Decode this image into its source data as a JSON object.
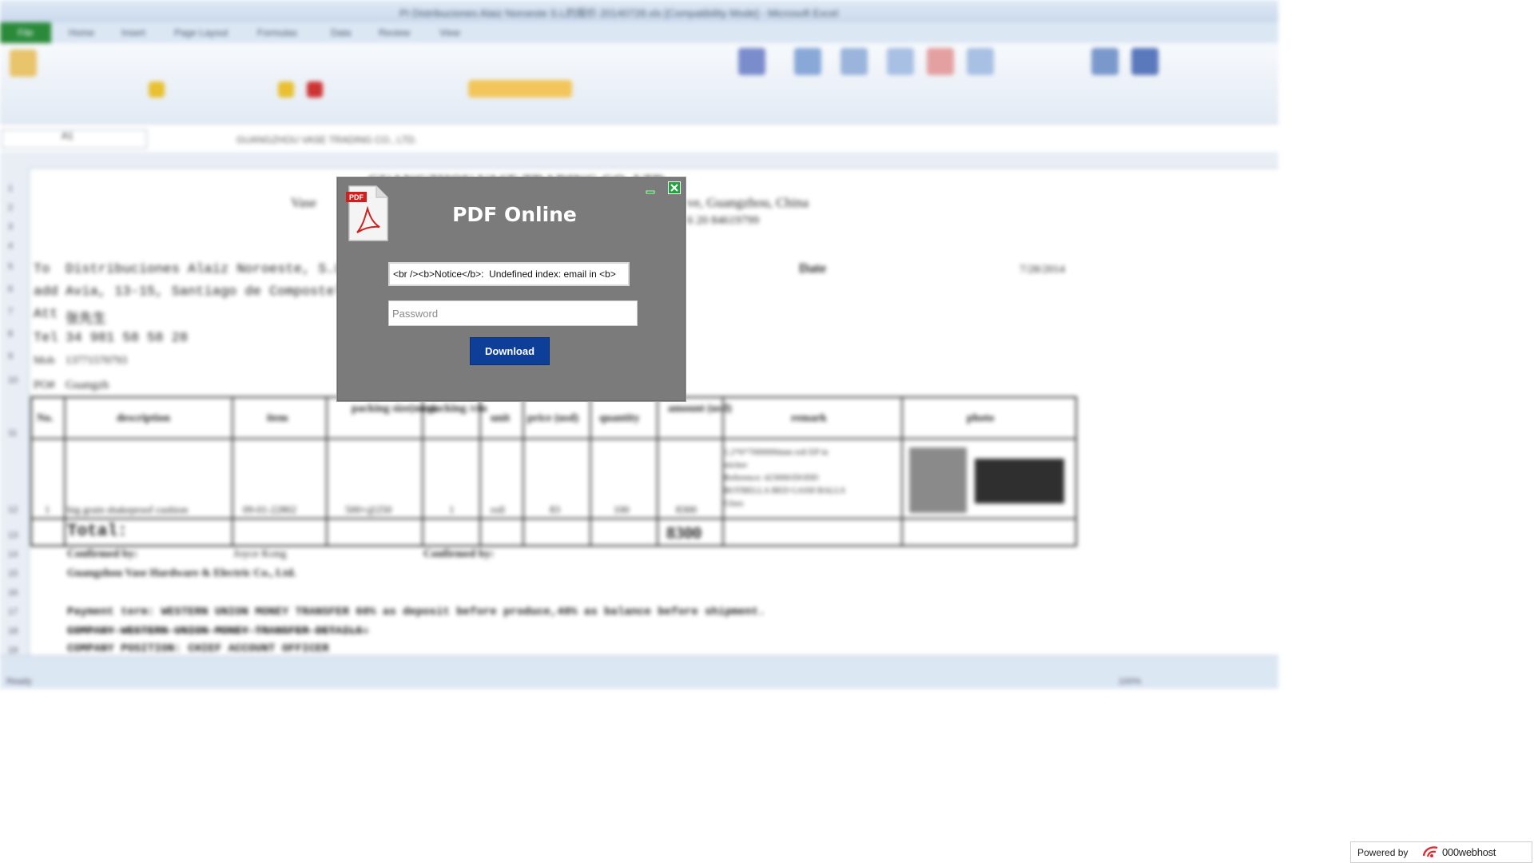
{
  "background": {
    "window_title": "PI Distribuciones Alaiz Noroeste S.L的报价 20140728.xls [Compatibility Mode] - Microsoft Excel",
    "file_tab": "File",
    "tabs": [
      "Home",
      "Insert",
      "Page Layout",
      "Formulas",
      "Data",
      "Review",
      "View"
    ],
    "name_box": "A1",
    "formula_text": "GUANGZHOU VASE TRADING CO., LTD.",
    "company_title": "GUANGZHOU VASE TRADING CO.,LTD.",
    "address_left": "Vase",
    "address_right": "ve, Guangzhou, China",
    "phone_fragment": "6 20 84619799",
    "to_label": "To",
    "to_value": "Distribuciones Alaiz Noroeste, S.L",
    "add_label": "add",
    "add_value": "Avia, 13-15, Santiago de Compostela,",
    "att_label": "Att",
    "att_value": "张先生",
    "tel_label": "Tel",
    "tel_value": "34 981 58 58 28",
    "mob_label": "Mob",
    "mob_value": "13771570793",
    "po_label": "PO#",
    "po_value": "Guangzh",
    "date_label": "Date",
    "date_value": "7/28/2014",
    "table_headers": [
      "No.",
      "description",
      "item",
      "packing size(mm)",
      "packing /ctn",
      "unit",
      "price (usd)",
      "quantity",
      "amount (usd)",
      "remark",
      "photo"
    ],
    "row_values": [
      "1",
      "big grain shakeproof cushion",
      "09-01-22802",
      "500×@250",
      "1",
      "roll",
      "83",
      "100",
      "8300"
    ],
    "remark_lines": [
      "1.2*6*7000000mm roll EP in",
      "sticker",
      "Reference: 423000/DODD",
      "BOTBELLA BED GASH BALLS",
      "Glass"
    ],
    "total_label": "Total:",
    "total_value": "8300",
    "confirmed_by_1": "Confirmed by:",
    "confirmed_name": "Joyce Kong",
    "confirmed_by_2": "Confirmed by:",
    "company_line": "Guangzhou Vase Hardware & Electric Co., Ltd.",
    "payment_line": "Payment term: WESTERN UNION MONEY TRANSFER 60% as deposit before produce,40% as balance before shipment.",
    "western_line": "COMPANY WESTERN UNION MONEY TRANSFER DETAILS:",
    "position_line": "COMPANY POSITION: CHIEF ACCOUNT OFFICER",
    "row_numbers": [
      "1",
      "2",
      "3",
      "4",
      "5",
      "6",
      "7",
      "8",
      "9",
      "10",
      "11",
      "12",
      "13",
      "14",
      "15",
      "16",
      "17",
      "18",
      "19"
    ],
    "status_text": "Ready",
    "zoom": "100%"
  },
  "modal": {
    "pdf_badge": "PDF",
    "title": "PDF Online",
    "email_value": "<br /><b>Notice</b>:  Undefined index: email in <b>",
    "password_placeholder": "Password",
    "download_label": "Download",
    "minimize_icon": "minimize-icon",
    "close_icon": "close-icon"
  },
  "footer": {
    "powered_by": "Powered by",
    "brand": "000webhost"
  }
}
